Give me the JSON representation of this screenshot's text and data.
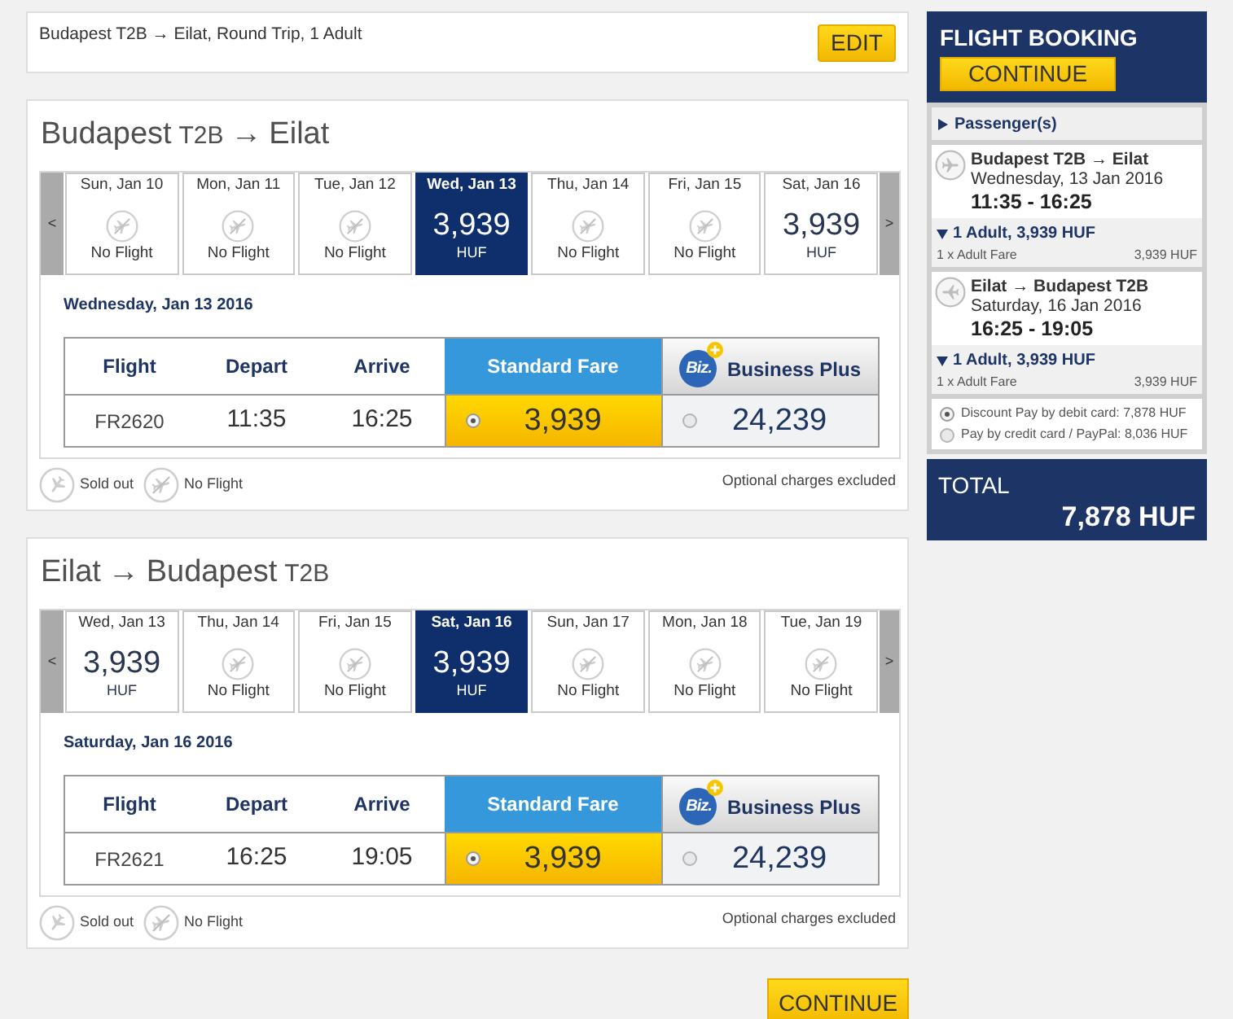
{
  "summary": {
    "text": "Budapest T2B → Eilat, Round Trip, 1 Adult",
    "edit_button": "EDIT"
  },
  "journeys": [
    {
      "title": [
        {
          "kind": "city",
          "text": "Budapest"
        },
        {
          "kind": "terminal",
          "text": "T2B"
        },
        {
          "kind": "arrow",
          "text": "→"
        },
        {
          "kind": "city",
          "text": "Eilat"
        }
      ],
      "prev": "<",
      "next": ">",
      "days": [
        {
          "label": "Sun, Jan 10",
          "kind": "no_flight",
          "status": "No Flight",
          "selected": false
        },
        {
          "label": "Mon, Jan 11",
          "kind": "no_flight",
          "status": "No Flight",
          "selected": false
        },
        {
          "label": "Tue, Jan 12",
          "kind": "no_flight",
          "status": "No Flight",
          "selected": false
        },
        {
          "label": "Wed, Jan 13",
          "kind": "fare",
          "price": "3,939",
          "currency": "HUF",
          "selected": true
        },
        {
          "label": "Thu, Jan 14",
          "kind": "no_flight",
          "status": "No Flight",
          "selected": false
        },
        {
          "label": "Fri, Jan 15",
          "kind": "no_flight",
          "status": "No Flight",
          "selected": false
        },
        {
          "label": "Sat, Jan 16",
          "kind": "fare",
          "price": "3,939",
          "currency": "HUF",
          "selected": false
        }
      ],
      "date_heading": "Wednesday, Jan 13 2016",
      "columns": [
        "Flight",
        "Depart",
        "Arrive"
      ],
      "fare_columns": [
        {
          "kind": "standard",
          "label": "Standard Fare"
        },
        {
          "kind": "business",
          "badge": "Biz.",
          "label": "Business Plus"
        }
      ],
      "row": {
        "flight": "FR2620",
        "depart": "11:35",
        "arrive": "16:25",
        "fares": [
          {
            "price": "3,939",
            "selected": true
          },
          {
            "price": "24,239",
            "selected": false
          }
        ]
      },
      "legend": [
        {
          "kind": "sold_out",
          "label": "Sold out"
        },
        {
          "kind": "no_flight",
          "label": "No Flight"
        }
      ],
      "note": "Optional charges excluded"
    },
    {
      "title": [
        {
          "kind": "city",
          "text": "Eilat"
        },
        {
          "kind": "arrow",
          "text": "→"
        },
        {
          "kind": "city",
          "text": "Budapest"
        },
        {
          "kind": "terminal",
          "text": "T2B"
        }
      ],
      "prev": "<",
      "next": ">",
      "days": [
        {
          "label": "Wed, Jan 13",
          "kind": "fare",
          "price": "3,939",
          "currency": "HUF",
          "selected": false
        },
        {
          "label": "Thu, Jan 14",
          "kind": "no_flight",
          "status": "No Flight",
          "selected": false
        },
        {
          "label": "Fri, Jan 15",
          "kind": "no_flight",
          "status": "No Flight",
          "selected": false
        },
        {
          "label": "Sat, Jan 16",
          "kind": "fare",
          "price": "3,939",
          "currency": "HUF",
          "selected": true
        },
        {
          "label": "Sun, Jan 17",
          "kind": "no_flight",
          "status": "No Flight",
          "selected": false
        },
        {
          "label": "Mon, Jan 18",
          "kind": "no_flight",
          "status": "No Flight",
          "selected": false
        },
        {
          "label": "Tue, Jan 19",
          "kind": "no_flight",
          "status": "No Flight",
          "selected": false
        }
      ],
      "date_heading": "Saturday, Jan 16 2016",
      "columns": [
        "Flight",
        "Depart",
        "Arrive"
      ],
      "fare_columns": [
        {
          "kind": "standard",
          "label": "Standard Fare"
        },
        {
          "kind": "business",
          "badge": "Biz.",
          "label": "Business Plus"
        }
      ],
      "row": {
        "flight": "FR2621",
        "depart": "16:25",
        "arrive": "19:05",
        "fares": [
          {
            "price": "3,939",
            "selected": true
          },
          {
            "price": "24,239",
            "selected": false
          }
        ]
      },
      "legend": [
        {
          "kind": "sold_out",
          "label": "Sold out"
        },
        {
          "kind": "no_flight",
          "label": "No Flight"
        }
      ],
      "note": "Optional charges excluded"
    }
  ],
  "continue_button": "CONTINUE",
  "sidebar": {
    "title": "FLIGHT BOOKING",
    "continue_button": "CONTINUE",
    "passengers": {
      "label": "Passenger(s)",
      "expanded": false
    },
    "flights": [
      {
        "kind": "outbound",
        "route": "Budapest T2B → Eilat",
        "date": "Wednesday, 13 Jan 2016",
        "times": "11:35 - 16:25",
        "fare": {
          "label": "1 Adult, 3,939 HUF",
          "expanded": true,
          "lines": [
            {
              "label": "1 x Adult Fare",
              "amount": "3,939 HUF"
            }
          ]
        }
      },
      {
        "kind": "inbound",
        "route": "Eilat → Budapest T2B",
        "date": "Saturday, 16 Jan 2016",
        "times": "16:25 - 19:05",
        "fare": {
          "label": "1 Adult, 3,939 HUF",
          "expanded": true,
          "lines": [
            {
              "label": "1 x Adult Fare",
              "amount": "3,939 HUF"
            }
          ]
        }
      }
    ],
    "payment_options": [
      {
        "label": "Discount Pay by debit card: 7,878 HUF",
        "selected": true
      },
      {
        "label": "Pay by credit card / PayPal: 8,036 HUF",
        "selected": false
      }
    ],
    "total": {
      "label": "TOTAL",
      "amount": "7,878 HUF"
    }
  }
}
